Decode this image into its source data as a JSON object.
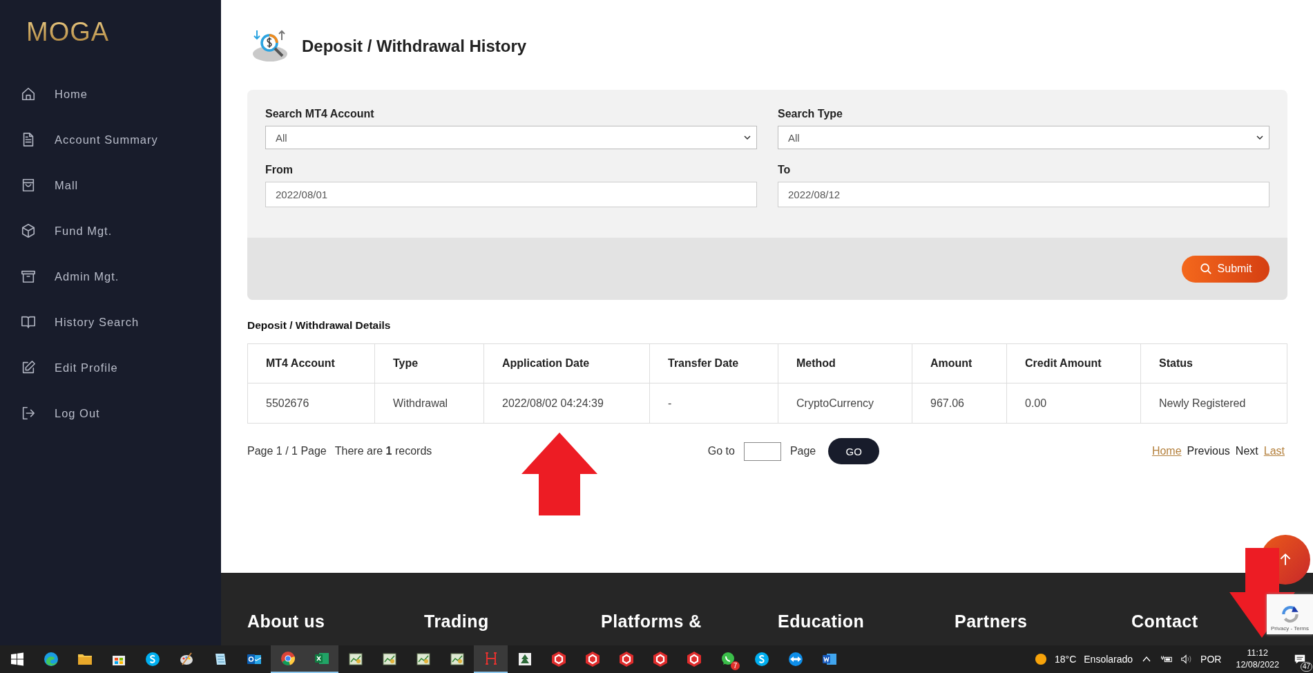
{
  "logo": {
    "text": "MOGA"
  },
  "sidebar": {
    "items": [
      {
        "label": "Home",
        "kind": "home"
      },
      {
        "label": "Account Summary",
        "kind": "document"
      },
      {
        "label": "Mall",
        "kind": "bag"
      },
      {
        "label": "Fund Mgt.",
        "kind": "cube"
      },
      {
        "label": "Admin Mgt.",
        "kind": "archive"
      },
      {
        "label": "History Search",
        "kind": "book"
      },
      {
        "label": "Edit Profile",
        "kind": "edit"
      },
      {
        "label": "Log Out",
        "kind": "logout"
      }
    ]
  },
  "page": {
    "title": "Deposit / Withdrawal History"
  },
  "filters": {
    "fields": [
      {
        "label": "Search MT4 Account",
        "kind": "select",
        "value": "All"
      },
      {
        "label": "Search Type",
        "kind": "select",
        "value": "All"
      },
      {
        "label": "From",
        "kind": "input",
        "value": "2022/08/01"
      },
      {
        "label": "To",
        "kind": "input",
        "value": "2022/08/12"
      }
    ],
    "submit": "Submit"
  },
  "details": {
    "title": "Deposit / Withdrawal Details",
    "columns": [
      "MT4 Account",
      "Type",
      "Application Date",
      "Transfer Date",
      "Method",
      "Amount",
      "Credit Amount",
      "Status"
    ],
    "rows": [
      [
        "5502676",
        "Withdrawal",
        "2022/08/02 04:24:39",
        "-",
        "CryptoCurrency",
        "967.06",
        "0.00",
        "Newly Registered"
      ]
    ]
  },
  "pagination": {
    "summary": "Page 1 / 1 Page",
    "records": "There are **1** records",
    "goto_label": "Go to",
    "page_label": "Page",
    "go_button": "GO",
    "links": [
      {
        "label": "Home",
        "linked": true
      },
      {
        "label": "Previous",
        "linked": false
      },
      {
        "label": "Next",
        "linked": false
      },
      {
        "label": "Last",
        "linked": true
      }
    ]
  },
  "footer": {
    "headings": [
      "About us",
      "Trading",
      "Platforms &",
      "Education",
      "Partners",
      "Contact"
    ]
  },
  "recaptcha": {
    "text": "Privacy - Terms"
  },
  "taskbar": {
    "apps": [
      {
        "kind": "windows",
        "active": false
      },
      {
        "kind": "edge",
        "active": false
      },
      {
        "kind": "folder",
        "active": false
      },
      {
        "kind": "store",
        "active": false
      },
      {
        "kind": "skype",
        "active": false
      },
      {
        "kind": "paint",
        "active": false
      },
      {
        "kind": "notepad",
        "active": false
      },
      {
        "kind": "outlook",
        "active": false
      },
      {
        "kind": "chrome",
        "active": true
      },
      {
        "kind": "excel",
        "active": true
      },
      {
        "kind": "chart",
        "active": false
      },
      {
        "kind": "chart",
        "active": false
      },
      {
        "kind": "chart",
        "active": false
      },
      {
        "kind": "chart",
        "active": false
      },
      {
        "kind": "hbox",
        "active": true
      },
      {
        "kind": "tree",
        "active": false
      },
      {
        "kind": "hex",
        "active": false
      },
      {
        "kind": "hex",
        "active": false
      },
      {
        "kind": "hex",
        "active": false
      },
      {
        "kind": "hex",
        "active": false
      },
      {
        "kind": "hex",
        "active": false
      },
      {
        "kind": "whatsapp",
        "active": false,
        "badge": "7"
      },
      {
        "kind": "skype",
        "active": false
      },
      {
        "kind": "teamviewer",
        "active": false
      },
      {
        "kind": "word",
        "active": false
      }
    ],
    "tray": {
      "temperature": "18°C",
      "weather": "Ensolarado",
      "language": "POR",
      "time": "11:12",
      "date": "12/08/2022",
      "notifications": "47"
    }
  }
}
